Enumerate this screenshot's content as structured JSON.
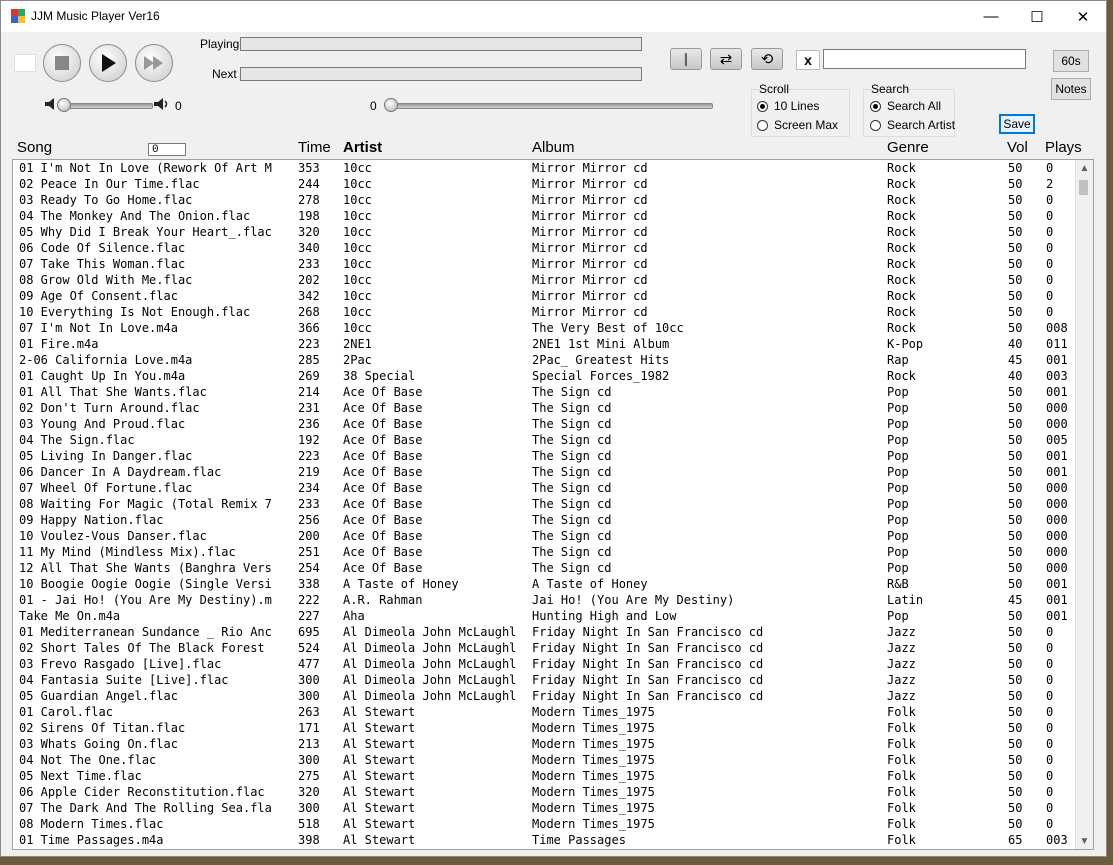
{
  "window": {
    "title": "JJM Music Player  Ver16",
    "minimize": "—",
    "maximize": "☐",
    "close": "✕"
  },
  "toolbar": {
    "playing_label": "Playing",
    "next_label": "Next",
    "playing_value": "",
    "next_value": "",
    "volume_value": "0",
    "position_value": "0",
    "pause_glyph": "❙",
    "shuffle_glyph": "⇄",
    "repeat_glyph": "⟲",
    "clear_label": "x",
    "search_value": "",
    "timer_label": "60s",
    "notes_label": "Notes",
    "save_label": "Save",
    "scroll_group": "Scroll",
    "scroll_options": [
      "10 Lines",
      "Screen Max"
    ],
    "scroll_selected": "10 Lines",
    "search_group": "Search",
    "search_options": [
      "Search All",
      "Search Artist"
    ],
    "search_selected": "Search All",
    "song_counter": "0"
  },
  "columns": {
    "song": "Song",
    "time": "Time",
    "artist": "Artist",
    "album": "Album",
    "genre": "Genre",
    "vol": "Vol",
    "plays": "Plays"
  },
  "rows": [
    [
      "01 I'm Not In Love (Rework Of Art M",
      "353",
      "10cc",
      "Mirror Mirror cd",
      "Rock",
      "50",
      "0"
    ],
    [
      "02 Peace In Our Time.flac",
      "244",
      "10cc",
      "Mirror Mirror cd",
      "Rock",
      "50",
      "2"
    ],
    [
      "03 Ready To Go Home.flac",
      "278",
      "10cc",
      "Mirror Mirror cd",
      "Rock",
      "50",
      "0"
    ],
    [
      "04 The Monkey And The Onion.flac",
      "198",
      "10cc",
      "Mirror Mirror cd",
      "Rock",
      "50",
      "0"
    ],
    [
      "05 Why Did I Break Your Heart_.flac",
      "320",
      "10cc",
      "Mirror Mirror cd",
      "Rock",
      "50",
      "0"
    ],
    [
      "06 Code Of Silence.flac",
      "340",
      "10cc",
      "Mirror Mirror cd",
      "Rock",
      "50",
      "0"
    ],
    [
      "07 Take This Woman.flac",
      "233",
      "10cc",
      "Mirror Mirror cd",
      "Rock",
      "50",
      "0"
    ],
    [
      "08 Grow Old With Me.flac",
      "202",
      "10cc",
      "Mirror Mirror cd",
      "Rock",
      "50",
      "0"
    ],
    [
      "09 Age Of Consent.flac",
      "342",
      "10cc",
      "Mirror Mirror cd",
      "Rock",
      "50",
      "0"
    ],
    [
      "10 Everything Is Not Enough.flac",
      "268",
      "10cc",
      "Mirror Mirror cd",
      "Rock",
      "50",
      "0"
    ],
    [
      "07 I'm Not In Love.m4a",
      "366",
      "10cc",
      "The Very Best of 10cc",
      "Rock",
      "50",
      "008"
    ],
    [
      "01 Fire.m4a",
      "223",
      "2NE1",
      "2NE1 1st Mini Album",
      "K-Pop",
      "40",
      "011"
    ],
    [
      "2-06 California Love.m4a",
      "285",
      "2Pac",
      "2Pac_ Greatest Hits",
      "Rap",
      "45",
      "001"
    ],
    [
      "01 Caught Up In You.m4a",
      "269",
      "38 Special",
      "Special Forces_1982",
      "Rock",
      "40",
      "003"
    ],
    [
      "01 All That She Wants.flac",
      "214",
      "Ace Of Base",
      "The Sign cd",
      "Pop",
      "50",
      "001"
    ],
    [
      "02 Don't Turn Around.flac",
      "231",
      "Ace Of Base",
      "The Sign cd",
      "Pop",
      "50",
      "000"
    ],
    [
      "03 Young And Proud.flac",
      "236",
      "Ace Of Base",
      "The Sign cd",
      "Pop",
      "50",
      "000"
    ],
    [
      "04 The Sign.flac",
      "192",
      "Ace Of Base",
      "The Sign cd",
      "Pop",
      "50",
      "005"
    ],
    [
      "05 Living In Danger.flac",
      "223",
      "Ace Of Base",
      "The Sign cd",
      "Pop",
      "50",
      "001"
    ],
    [
      "06 Dancer In A Daydream.flac",
      "219",
      "Ace Of Base",
      "The Sign cd",
      "Pop",
      "50",
      "001"
    ],
    [
      "07 Wheel Of Fortune.flac",
      "234",
      "Ace Of Base",
      "The Sign cd",
      "Pop",
      "50",
      "000"
    ],
    [
      "08 Waiting For Magic (Total Remix 7",
      "233",
      "Ace Of Base",
      "The Sign cd",
      "Pop",
      "50",
      "000"
    ],
    [
      "09 Happy Nation.flac",
      "256",
      "Ace Of Base",
      "The Sign cd",
      "Pop",
      "50",
      "000"
    ],
    [
      "10 Voulez-Vous Danser.flac",
      "200",
      "Ace Of Base",
      "The Sign cd",
      "Pop",
      "50",
      "000"
    ],
    [
      "11 My Mind (Mindless Mix).flac",
      "251",
      "Ace Of Base",
      "The Sign cd",
      "Pop",
      "50",
      "000"
    ],
    [
      "12 All That She Wants (Banghra Vers",
      "254",
      "Ace Of Base",
      "The Sign cd",
      "Pop",
      "50",
      "000"
    ],
    [
      "10 Boogie Oogie Oogie (Single Versi",
      "338",
      "A Taste of Honey",
      "A Taste of Honey",
      "R&B",
      "50",
      "001"
    ],
    [
      "01 - Jai Ho! (You Are My Destiny).m",
      "222",
      "A.R. Rahman",
      "Jai Ho! (You Are My Destiny)",
      "Latin",
      "45",
      "001"
    ],
    [
      "Take Me On.m4a",
      "227",
      "Aha",
      "Hunting High and Low",
      "Pop",
      "50",
      "001"
    ],
    [
      "01 Mediterranean Sundance _ Rio Anc",
      "695",
      "Al Dimeola John McLaughl",
      "Friday Night In San Francisco cd",
      "Jazz",
      "50",
      "0"
    ],
    [
      "02 Short Tales Of The Black Forest",
      "524",
      "Al Dimeola John McLaughl",
      "Friday Night In San Francisco cd",
      "Jazz",
      "50",
      "0"
    ],
    [
      "03 Frevo Rasgado [Live].flac",
      "477",
      "Al Dimeola John McLaughl",
      "Friday Night In San Francisco cd",
      "Jazz",
      "50",
      "0"
    ],
    [
      "04 Fantasia Suite [Live].flac",
      "300",
      "Al Dimeola John McLaughl",
      "Friday Night In San Francisco cd",
      "Jazz",
      "50",
      "0"
    ],
    [
      "05 Guardian Angel.flac",
      "300",
      "Al Dimeola John McLaughl",
      "Friday Night In San Francisco cd",
      "Jazz",
      "50",
      "0"
    ],
    [
      "01 Carol.flac",
      "263",
      "Al Stewart",
      "Modern Times_1975",
      "Folk",
      "50",
      "0"
    ],
    [
      "02 Sirens Of Titan.flac",
      "171",
      "Al Stewart",
      "Modern Times_1975",
      "Folk",
      "50",
      "0"
    ],
    [
      "03 Whats Going On.flac",
      "213",
      "Al Stewart",
      "Modern Times_1975",
      "Folk",
      "50",
      "0"
    ],
    [
      "04 Not The One.flac",
      "300",
      "Al Stewart",
      "Modern Times_1975",
      "Folk",
      "50",
      "0"
    ],
    [
      "05 Next Time.flac",
      "275",
      "Al Stewart",
      "Modern Times_1975",
      "Folk",
      "50",
      "0"
    ],
    [
      "06 Apple Cider Reconstitution.flac",
      "320",
      "Al Stewart",
      "Modern Times_1975",
      "Folk",
      "50",
      "0"
    ],
    [
      "07 The Dark And The Rolling Sea.fla",
      "300",
      "Al Stewart",
      "Modern Times_1975",
      "Folk",
      "50",
      "0"
    ],
    [
      "08 Modern Times.flac",
      "518",
      "Al Stewart",
      "Modern Times_1975",
      "Folk",
      "50",
      "0"
    ],
    [
      "01 Time Passages.m4a",
      "398",
      "Al Stewart",
      "Time Passages",
      "Folk",
      "65",
      "003"
    ]
  ]
}
